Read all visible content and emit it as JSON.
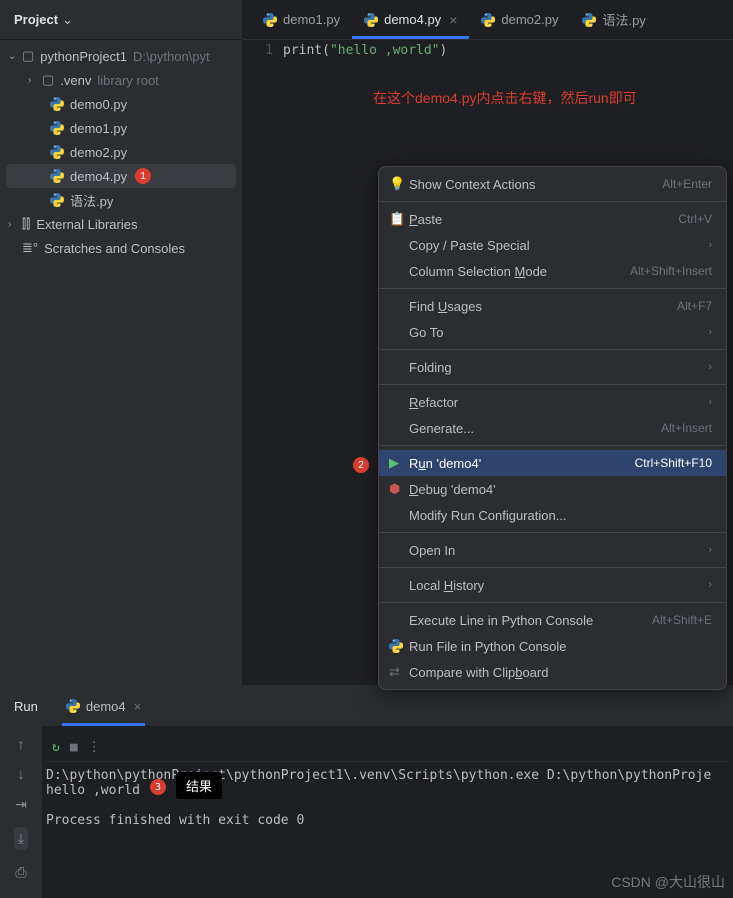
{
  "sidebar": {
    "title": "Project",
    "project": {
      "name": "pythonProject1",
      "path": "D:\\python\\pyt"
    },
    "venv": {
      "name": ".venv",
      "hint": "library root"
    },
    "files": [
      {
        "name": "demo0.py"
      },
      {
        "name": "demo1.py"
      },
      {
        "name": "demo2.py"
      },
      {
        "name": "demo4.py",
        "selected": true,
        "badge": "1"
      },
      {
        "name": "语法.py"
      }
    ],
    "ext_libs": "External Libraries",
    "scratches": "Scratches and Consoles"
  },
  "tabs": [
    {
      "name": "demo1.py"
    },
    {
      "name": "demo4.py",
      "active": true
    },
    {
      "name": "demo2.py"
    },
    {
      "name": "语法.py"
    }
  ],
  "code": {
    "line_no": "1",
    "fn": "print",
    "lp": "(",
    "str": "\"hello ,world\"",
    "rp": ")"
  },
  "annotation": "在这个demo4.py内点击右键，然后run即可",
  "context_menu": {
    "badge2": "2",
    "items": {
      "show_ctx": {
        "label": "Show Context Actions",
        "shortcut": "Alt+Enter"
      },
      "paste": {
        "prefix": "",
        "u": "P",
        "suffix": "aste",
        "shortcut": "Ctrl+V"
      },
      "copy_special": {
        "label": "Copy / Paste Special"
      },
      "col_sel": {
        "prefix": "Column Selection ",
        "u": "M",
        "suffix": "ode",
        "shortcut": "Alt+Shift+Insert"
      },
      "find_usages": {
        "prefix": "Find ",
        "u": "U",
        "suffix": "sages",
        "shortcut": "Alt+F7"
      },
      "goto": {
        "label": "Go To"
      },
      "folding": {
        "label": "Folding"
      },
      "refactor": {
        "prefix": "",
        "u": "R",
        "suffix": "efactor"
      },
      "generate": {
        "label": "Generate...",
        "shortcut": "Alt+Insert"
      },
      "run": {
        "prefix": "R",
        "u": "u",
        "suffix": "n 'demo4'",
        "shortcut": "Ctrl+Shift+F10"
      },
      "debug": {
        "prefix": "",
        "u": "D",
        "suffix": "ebug 'demo4'"
      },
      "modify": {
        "label": "Modify Run Configuration..."
      },
      "open_in": {
        "label": "Open In"
      },
      "local_hist": {
        "prefix": "Local ",
        "u": "H",
        "suffix": "istory"
      },
      "exec_line": {
        "label": "Execute Line in Python Console",
        "shortcut": "Alt+Shift+E"
      },
      "run_console": {
        "label": "Run File in Python Console"
      },
      "compare": {
        "prefix": "Compare with Clip",
        "u": "b",
        "suffix": "oard"
      }
    }
  },
  "run": {
    "title": "Run",
    "tab": "demo4",
    "output_line1": "D:\\python\\pythonProject\\pythonProject1\\.venv\\Scripts\\python.exe D:\\python\\pythonProje",
    "output_line2": "hello ,world",
    "output_line3": "Process finished with exit code 0",
    "badge3": "3",
    "result_label": "结果"
  },
  "watermark": "CSDN @大山很山"
}
